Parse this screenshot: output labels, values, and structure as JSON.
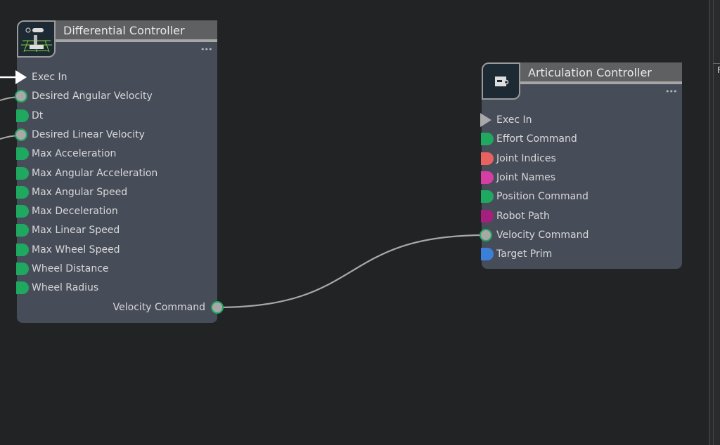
{
  "nodes": {
    "differential": {
      "title": "Differential Controller",
      "icon": "robot-arm-icon",
      "menu_label": "•••",
      "inputs": [
        {
          "label": "Exec In",
          "type": "exec",
          "color": "#ffffff"
        },
        {
          "label": "Desired Angular Velocity",
          "color": "#1fa85f",
          "connected": true
        },
        {
          "label": "Dt",
          "color": "#1fa85f"
        },
        {
          "label": "Desired Linear Velocity",
          "color": "#1fa85f",
          "connected": true
        },
        {
          "label": "Max Acceleration",
          "color": "#1fa85f"
        },
        {
          "label": "Max Angular Acceleration",
          "color": "#1fa85f"
        },
        {
          "label": "Max Angular Speed",
          "color": "#1fa85f"
        },
        {
          "label": "Max Deceleration",
          "color": "#1fa85f"
        },
        {
          "label": "Max Linear Speed",
          "color": "#1fa85f"
        },
        {
          "label": "Max Wheel Speed",
          "color": "#1fa85f"
        },
        {
          "label": "Wheel Distance",
          "color": "#1fa85f"
        },
        {
          "label": "Wheel Radius",
          "color": "#1fa85f"
        }
      ],
      "output": {
        "label": "Velocity Command",
        "color": "#1fa85f"
      }
    },
    "articulation": {
      "title": "Articulation Controller",
      "icon": "prim-tag-icon",
      "menu_label": "•••",
      "inputs": [
        {
          "label": "Exec In",
          "type": "exec",
          "color": "#a9a9a9"
        },
        {
          "label": "Effort Command",
          "color": "#1fa85f"
        },
        {
          "label": "Joint Indices",
          "color": "#e8625f"
        },
        {
          "label": "Joint Names",
          "color": "#d63ea4"
        },
        {
          "label": "Position Command",
          "color": "#1fa85f"
        },
        {
          "label": "Robot Path",
          "color": "#a5207e"
        },
        {
          "label": "Velocity Command",
          "color": "#1fa85f",
          "connected": true
        },
        {
          "label": "Target Prim",
          "color": "#3b7fd9"
        }
      ]
    }
  },
  "right_panel": {
    "partial_label": "F"
  }
}
